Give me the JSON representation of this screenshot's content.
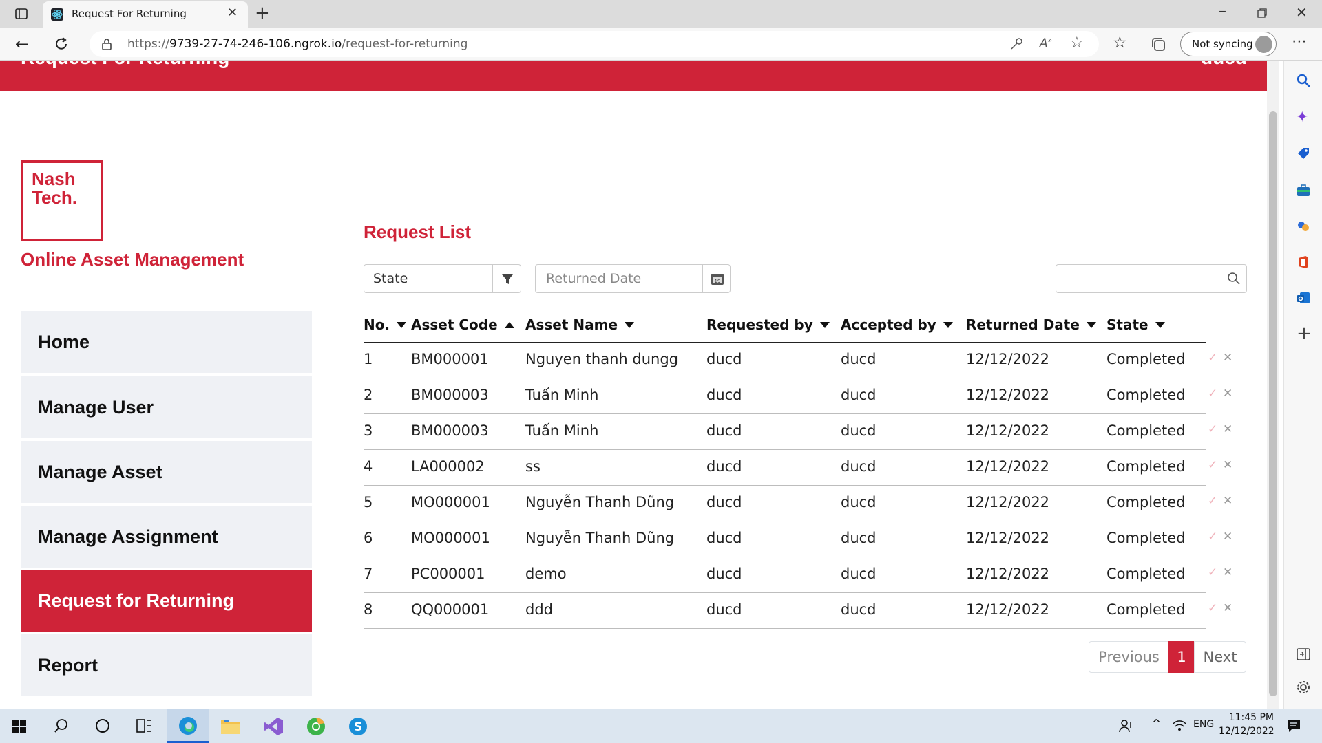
{
  "browser": {
    "tab_title": "Request For Returning",
    "url_prefix": "https://",
    "url_host": "9739-27-74-246-106.ngrok.io",
    "url_path": "/request-for-returning",
    "sync_label": "Not syncing"
  },
  "header": {
    "title": "Request For Returning",
    "user": "ducd"
  },
  "logo": {
    "line1": "Nash",
    "line2": "Tech."
  },
  "app_title": "Online Asset Management",
  "nav": [
    {
      "label": "Home",
      "active": false
    },
    {
      "label": "Manage User",
      "active": false
    },
    {
      "label": "Manage Asset",
      "active": false
    },
    {
      "label": "Manage Assignment",
      "active": false
    },
    {
      "label": "Request for Returning",
      "active": true
    },
    {
      "label": "Report",
      "active": false
    }
  ],
  "list_title": "Request List",
  "filters": {
    "state_label": "State",
    "date_placeholder": "Returned Date",
    "search_value": ""
  },
  "columns": [
    {
      "label": "No.",
      "sort": "desc"
    },
    {
      "label": "Asset Code",
      "sort": "asc"
    },
    {
      "label": "Asset Name",
      "sort": "desc"
    },
    {
      "label": "Requested by",
      "sort": "desc"
    },
    {
      "label": "Accepted by",
      "sort": "desc"
    },
    {
      "label": "Returned Date",
      "sort": "desc"
    },
    {
      "label": "State",
      "sort": "desc"
    }
  ],
  "rows": [
    {
      "no": "1",
      "code": "BM000001",
      "name": "Nguyen thanh dungg",
      "requested": "ducd",
      "accepted": "ducd",
      "date": "12/12/2022",
      "state": "Completed"
    },
    {
      "no": "2",
      "code": "BM000003",
      "name": "Tuấn Minh",
      "requested": "ducd",
      "accepted": "ducd",
      "date": "12/12/2022",
      "state": "Completed"
    },
    {
      "no": "3",
      "code": "BM000003",
      "name": "Tuấn Minh",
      "requested": "ducd",
      "accepted": "ducd",
      "date": "12/12/2022",
      "state": "Completed"
    },
    {
      "no": "4",
      "code": "LA000002",
      "name": "ss",
      "requested": "ducd",
      "accepted": "ducd",
      "date": "12/12/2022",
      "state": "Completed"
    },
    {
      "no": "5",
      "code": "MO000001",
      "name": "Nguyễn Thanh Dũng",
      "requested": "ducd",
      "accepted": "ducd",
      "date": "12/12/2022",
      "state": "Completed"
    },
    {
      "no": "6",
      "code": "MO000001",
      "name": "Nguyễn Thanh Dũng",
      "requested": "ducd",
      "accepted": "ducd",
      "date": "12/12/2022",
      "state": "Completed"
    },
    {
      "no": "7",
      "code": "PC000001",
      "name": "demo",
      "requested": "ducd",
      "accepted": "ducd",
      "date": "12/12/2022",
      "state": "Completed"
    },
    {
      "no": "8",
      "code": "QQ000001",
      "name": "ddd",
      "requested": "ducd",
      "accepted": "ducd",
      "date": "12/12/2022",
      "state": "Completed"
    }
  ],
  "row_actions": {
    "accept": "✓",
    "cancel": "✕"
  },
  "pagination": {
    "previous": "Previous",
    "current": "1",
    "next": "Next"
  },
  "taskbar": {
    "lang": "ENG",
    "time": "11:45 PM",
    "date": "12/12/2022"
  },
  "colors": {
    "brand": "#cf2338",
    "nav_bg": "#eff1f5"
  },
  "icons": [
    "calendar-icon",
    "filter-icon",
    "search-icon",
    "lock-icon",
    "edge-icon",
    "skype-icon"
  ]
}
